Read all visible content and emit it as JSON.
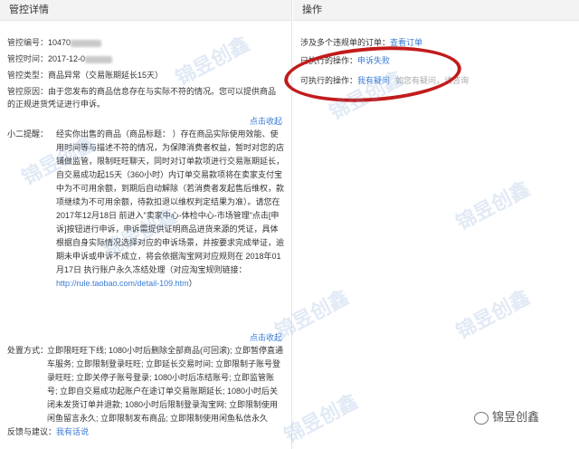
{
  "detail": {
    "header": "管控详情",
    "rows": [
      {
        "label": "管控编号：",
        "value": "10470"
      },
      {
        "label": "管控时间：",
        "value": "2017-12-0"
      },
      {
        "label": "管控类型：",
        "value": "商品异常（交易账期延长15天）"
      },
      {
        "label": "管控原因：",
        "value": "由于您发布的商品信息存在与实际不符的情况。您可以提供商品的正规进货凭证进行申诉。"
      }
    ],
    "collapse_label": "点击收起",
    "note_label": "小二提醒：",
    "note_text": "经实你出售的商品（商品标题：                  ）存在商品实际使用效能、使用时间等与描述不符的情况，为保障消费者权益，暂时对您的店铺做监管，限制旺旺聊天，同时对订单款项进行交易账期延长，自交易成功起15天（360小时）内订单交易款项将在卖家支付宝中为不可用余额，到期后自动解除（若消费者发起售后维权，款项继续为不可用余额，待款扣退以维权判定结果为准）。请您在 2017年12月18日 前进入\"卖家中心-体检中心-市场管理\"点击[申诉]按钮进行申诉，申诉需提供证明商品进货来源的凭证，具体根据自身实际情况选择对应的申诉场景，并按要求完成举证，逾期未申诉或申诉不成立，将会依据淘宝网对应规则在 2018年01月17日 执行账户永久冻结处理（对应淘宝规则链接：",
    "note_link": "http://rule.taobao.com/detail-109.htm",
    "note_end": "）",
    "collapse_label2": "点击收起",
    "action_label": "处置方式：",
    "action_text": "立即限旺旺下线; 1080小时后删除全部商品(可回滚); 立即暂停直通车服务; 立即限制登录旺旺; 立即延长交易时间; 立即限制子账号登录旺旺; 立即关停子账号登录; 1080小时后冻结账号; 立即监管账号; 立即自交易成功起账户在途订单交易账期延长; 1080小时后关闭未发货订单并退款; 1080小时后限制登录淘宝网; 立即限制使用闲鱼留言永久; 立即限制发布商品; 立即限制使用闲鱼私信永久",
    "feedback_label": "反馈与建议：",
    "feedback_link": "我有话说"
  },
  "ops": {
    "header": "操作",
    "rows": [
      {
        "label": "涉及多个违规单的订单：",
        "link": "查看订单",
        "tail": ""
      },
      {
        "label": "已执行的操作：",
        "link": "申诉失败",
        "tail": ""
      },
      {
        "label": "可执行的操作：",
        "link": "我有疑问",
        "tail": "如您有疑问，请咨询"
      }
    ]
  },
  "watermark": "锦昱创鑫",
  "logo_text": "锦昱创鑫"
}
